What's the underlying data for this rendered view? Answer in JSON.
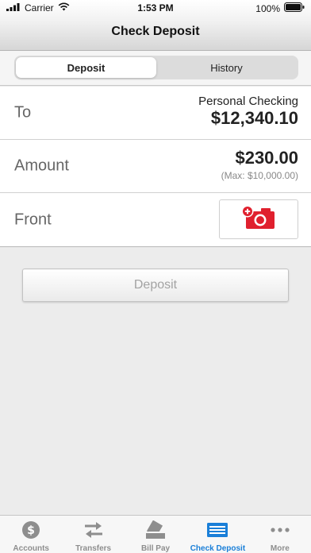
{
  "status_bar": {
    "carrier": "Carrier",
    "time": "1:53 PM",
    "battery": "100%"
  },
  "header": {
    "title": "Check Deposit"
  },
  "segments": [
    {
      "label": "Deposit",
      "active": true
    },
    {
      "label": "History",
      "active": false
    }
  ],
  "form": {
    "to": {
      "label": "To",
      "account_name": "Personal Checking",
      "account_balance": "$12,340.10"
    },
    "amount": {
      "label": "Amount",
      "value": "$230.00",
      "max_note": "(Max: $10,000.00)"
    },
    "front": {
      "label": "Front",
      "icon": "add-camera-icon"
    }
  },
  "deposit_button": {
    "label": "Deposit",
    "enabled": false
  },
  "tabbar": {
    "items": [
      {
        "label": "Accounts",
        "icon": "dollar-coin-icon",
        "active": false
      },
      {
        "label": "Transfers",
        "icon": "transfer-arrows-icon",
        "active": false
      },
      {
        "label": "Bill Pay",
        "icon": "bill-pay-icon",
        "active": false
      },
      {
        "label": "Check Deposit",
        "icon": "check-deposit-icon",
        "active": true
      },
      {
        "label": "More",
        "icon": "more-dots-icon",
        "active": false
      }
    ]
  },
  "colors": {
    "accent": "#1a7fd8",
    "camera_red": "#e0202e",
    "inactive_tab": "#8e8e8e"
  }
}
